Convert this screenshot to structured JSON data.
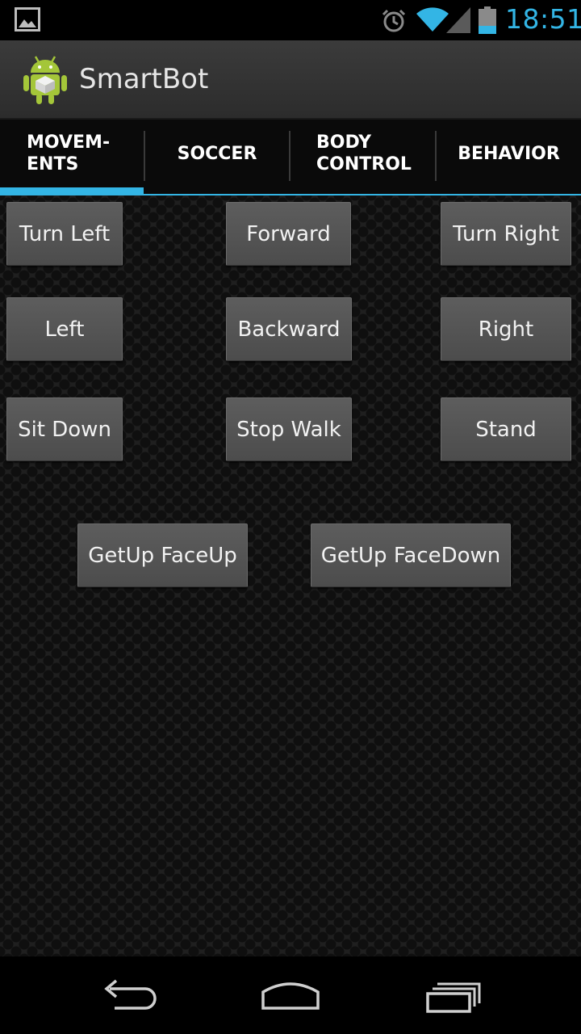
{
  "status_bar": {
    "time": "18:51",
    "icons": [
      "gallery-icon",
      "alarm-icon",
      "wifi-icon",
      "cell-signal-icon",
      "battery-icon"
    ],
    "clock_color": "#33b5e5"
  },
  "action_bar": {
    "title": "SmartBot",
    "icon": "android-robot-icon"
  },
  "tabs": [
    {
      "label": "MOVEM-\nENTS",
      "selected": true
    },
    {
      "label": "SOCCER",
      "selected": false
    },
    {
      "label": "BODY\nCONTROL",
      "selected": false
    },
    {
      "label": "BEHAVIOR",
      "selected": false
    }
  ],
  "accent_color": "#33b5e5",
  "buttons": {
    "turn_left": "Turn Left",
    "forward": "Forward",
    "turn_right": "Turn Right",
    "left": "Left",
    "backward": "Backward",
    "right": "Right",
    "sit_down": "Sit Down",
    "stop_walk": "Stop Walk",
    "stand": "Stand",
    "getup_faceup": "GetUp FaceUp",
    "getup_facedown": "GetUp FaceDown"
  },
  "nav_bar": {
    "icons": [
      "back-icon",
      "home-icon",
      "recent-apps-icon"
    ]
  }
}
